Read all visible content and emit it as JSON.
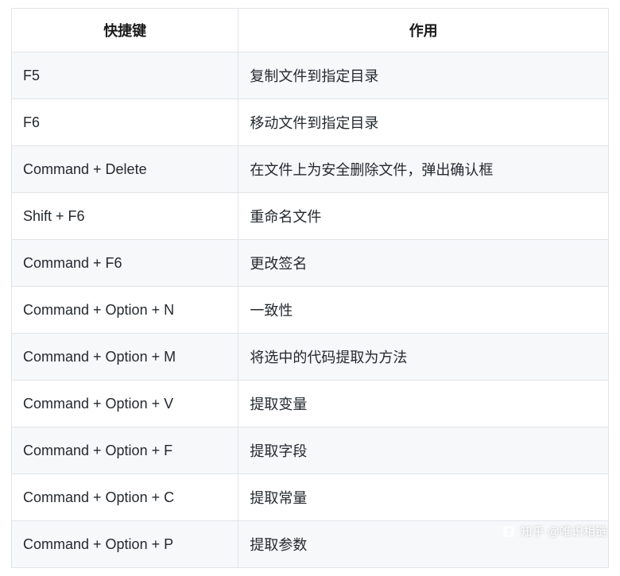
{
  "table": {
    "headers": [
      "快捷键",
      "作用"
    ],
    "rows": [
      {
        "shortcut": "F5",
        "action": "复制文件到指定目录"
      },
      {
        "shortcut": "F6",
        "action": "移动文件到指定目录"
      },
      {
        "shortcut": "Command + Delete",
        "action": "在文件上为安全删除文件，弹出确认框"
      },
      {
        "shortcut": "Shift + F6",
        "action": "重命名文件"
      },
      {
        "shortcut": "Command + F6",
        "action": "更改签名"
      },
      {
        "shortcut": "Command + Option + N",
        "action": "一致性"
      },
      {
        "shortcut": "Command + Option + M",
        "action": "将选中的代码提取为方法"
      },
      {
        "shortcut": "Command + Option + V",
        "action": "提取变量"
      },
      {
        "shortcut": "Command + Option + F",
        "action": "提取字段"
      },
      {
        "shortcut": "Command + Option + C",
        "action": "提取常量"
      },
      {
        "shortcut": "Command + Option + P",
        "action": "提取参数"
      }
    ]
  },
  "watermark": {
    "text": "知乎 @唯识相链"
  }
}
